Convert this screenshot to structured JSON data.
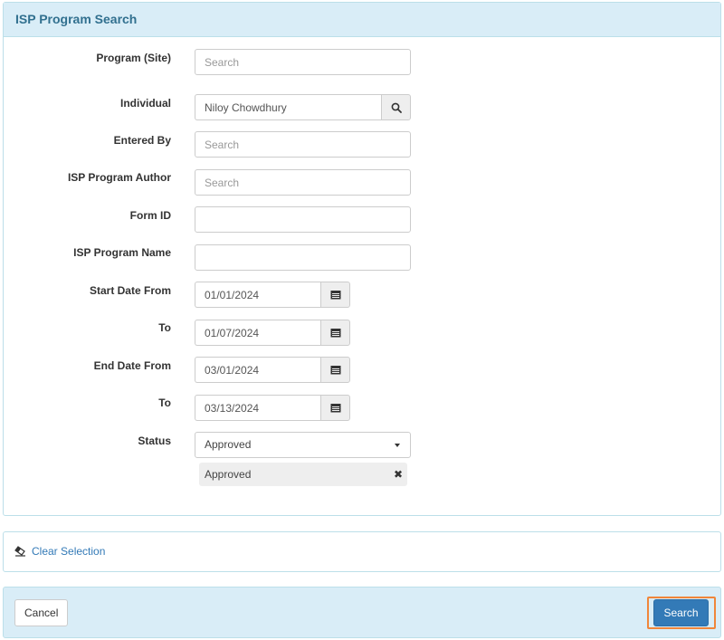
{
  "panel": {
    "title": "ISP Program Search"
  },
  "fields": {
    "program_site": {
      "label": "Program (Site)",
      "placeholder": "Search",
      "value": ""
    },
    "individual": {
      "label": "Individual",
      "value": "Niloy Chowdhury"
    },
    "entered_by": {
      "label": "Entered By",
      "placeholder": "Search",
      "value": ""
    },
    "isp_author": {
      "label": "ISP Program Author",
      "placeholder": "Search",
      "value": ""
    },
    "form_id": {
      "label": "Form ID",
      "value": ""
    },
    "isp_name": {
      "label": "ISP Program Name",
      "value": ""
    },
    "start_from": {
      "label": "Start Date From",
      "value": "01/01/2024"
    },
    "start_to": {
      "label": "To",
      "value": "01/07/2024"
    },
    "end_from": {
      "label": "End Date From",
      "value": "03/01/2024"
    },
    "end_to": {
      "label": "To",
      "value": "03/13/2024"
    },
    "status": {
      "label": "Status",
      "selected": "Approved",
      "tags": [
        "Approved"
      ]
    }
  },
  "icons": {
    "individual_addon": "search-icon",
    "date_addon": "calendar-icon",
    "clear": "eraser-icon",
    "tag_remove": "close-icon",
    "select": "caret-down-icon"
  },
  "clear_selection": {
    "label": "Clear Selection"
  },
  "footer": {
    "cancel_label": "Cancel",
    "search_label": "Search"
  },
  "colors": {
    "heading_bg": "#d9edf7",
    "heading_text": "#31708f",
    "primary": "#337ab7",
    "focus_outline": "#f0863a"
  }
}
